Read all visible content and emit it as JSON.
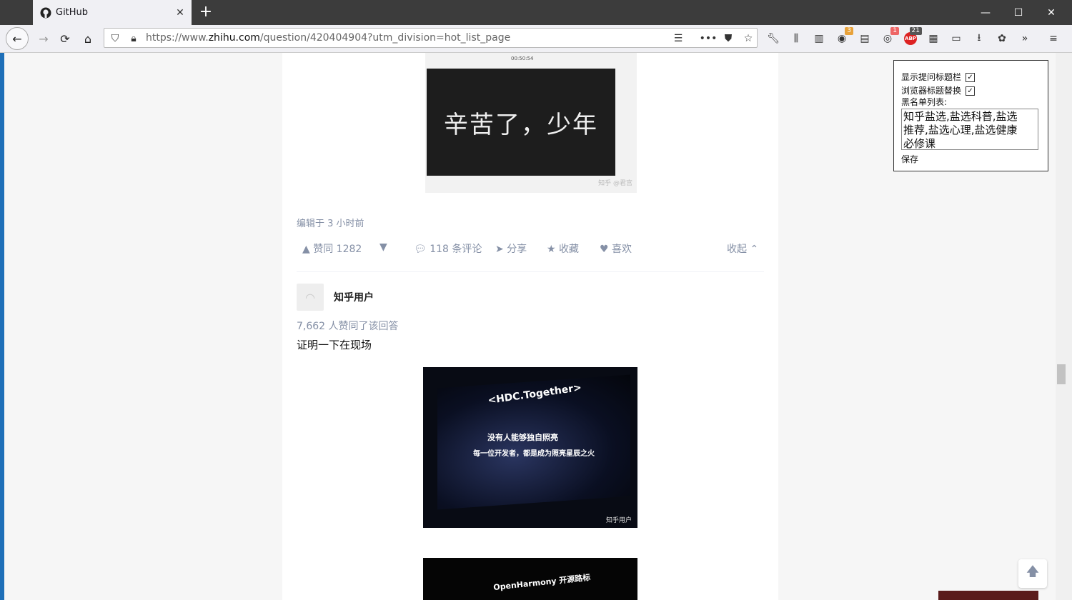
{
  "browser": {
    "tab_title": "GitHub",
    "url_host_prefix": "https://www.",
    "url_host": "zhihu.com",
    "url_path": "/question/420404904?utm_division=hot_list_page",
    "ext_badge_1": "3",
    "ext_badge_2": "1",
    "ext_badge_3": "21",
    "abp_label": "ABP"
  },
  "answer1": {
    "image_text": "辛苦了，少年",
    "image_time": "00:50:54",
    "image_watermark": "知乎 @君宫",
    "edited": "编辑于 3 小时前",
    "upvote": "赞同 1282",
    "comments": "118 条评论",
    "share": "分享",
    "favorite": "收藏",
    "like": "喜欢",
    "collapse": "收起"
  },
  "answer2": {
    "author": "知乎用户",
    "votes": "7,662 人赞同了该回答",
    "text": "证明一下在现场",
    "image1_hdc": "<HDC.Together>",
    "image1_line1": "没有人能够独自照亮",
    "image1_line2": "每一位开发者，都是成为照亮星辰之火",
    "image1_watermark": "知乎用户",
    "image2_text": "OpenHarmony 开源路标"
  },
  "panel": {
    "show_title_label": "显示提问标题栏",
    "show_title_checked": true,
    "replace_title_label": "浏览器标题替换",
    "replace_title_checked": true,
    "blacklist_label": "黑名单列表:",
    "blacklist_value": "知乎盐选,盐选科普,盐选推荐,盐选心理,盐选健康必修课",
    "save_label": "保存"
  }
}
